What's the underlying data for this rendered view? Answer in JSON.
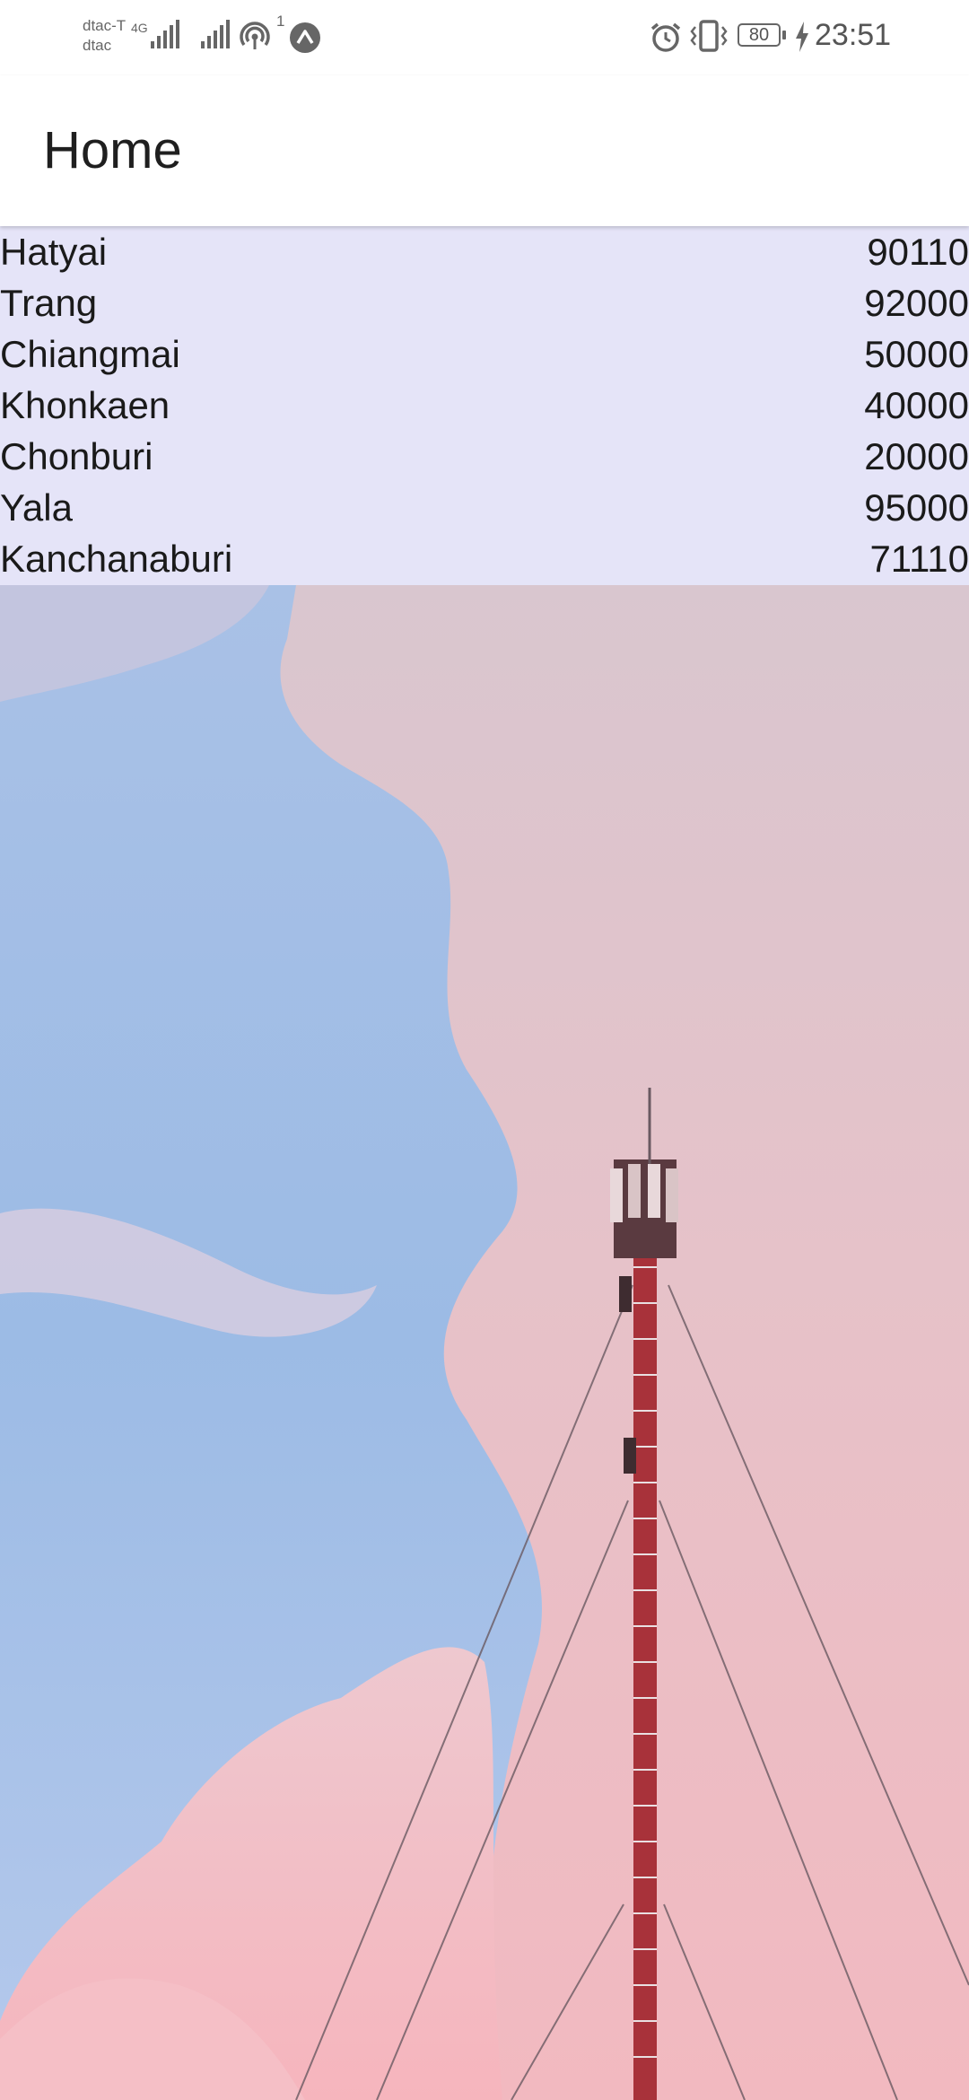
{
  "status_bar": {
    "carrier_primary": "dtac-T",
    "carrier_secondary": "dtac",
    "network_type": "4G",
    "hotspot_count": "1",
    "battery_level": "80",
    "time": "23:51",
    "icons": [
      "signal-icon",
      "hotspot-icon",
      "app-notification-icon",
      "alarm-icon",
      "vibrate-icon",
      "battery-icon",
      "charging-icon"
    ]
  },
  "app_bar": {
    "title": "Home"
  },
  "cities": [
    {
      "name": "Hatyai",
      "zip": "90110"
    },
    {
      "name": "Trang",
      "zip": "92000"
    },
    {
      "name": "Chiangmai",
      "zip": "50000"
    },
    {
      "name": "Khonkaen",
      "zip": "40000"
    },
    {
      "name": "Chonburi",
      "zip": "20000"
    },
    {
      "name": "Yala",
      "zip": "95000"
    },
    {
      "name": "Kanchanaburi",
      "zip": "71110"
    }
  ],
  "colors": {
    "list_background": "#e5e4f8",
    "sky_blue": "#9dbde6",
    "cloud_pink": "#f0c2c7",
    "tower_red": "#b13a2e"
  },
  "background_image": {
    "subject": "telecom-tower-pink-clouds"
  }
}
